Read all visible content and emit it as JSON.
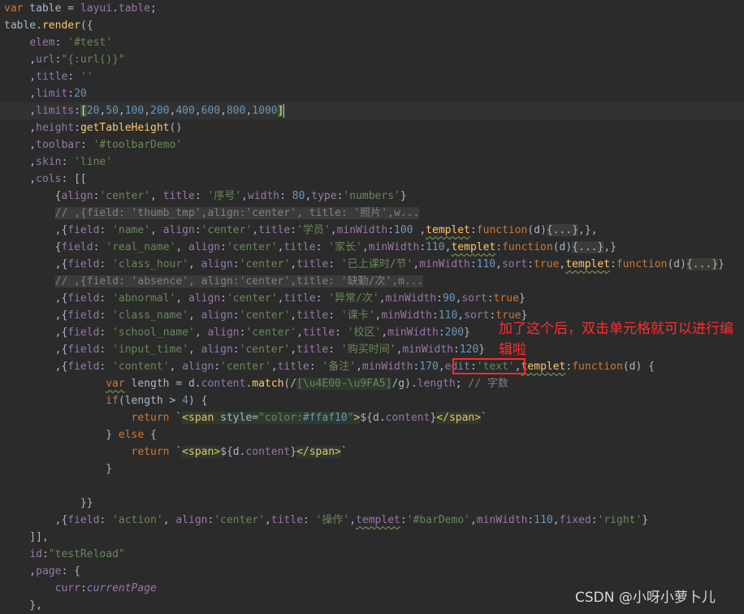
{
  "editor": {
    "highlighted_line": 7,
    "lines": [
      [
        [
          "k",
          "var"
        ],
        [
          "t",
          " table = "
        ],
        [
          "p",
          "layui"
        ],
        [
          "t",
          "."
        ],
        [
          "p",
          "table"
        ],
        [
          "t",
          ";"
        ]
      ],
      [
        [
          "t",
          "table."
        ],
        [
          "f",
          "render"
        ],
        [
          "t",
          "({"
        ]
      ],
      [
        [
          "t",
          "    "
        ],
        [
          "p",
          "elem"
        ],
        [
          "t",
          ": "
        ],
        [
          "s",
          "'#test'"
        ]
      ],
      [
        [
          "t",
          "    ,"
        ],
        [
          "p",
          "url"
        ],
        [
          "t",
          ":"
        ],
        [
          "s",
          "\"{:url()}\""
        ]
      ],
      [
        [
          "t",
          "    ,"
        ],
        [
          "p",
          "title"
        ],
        [
          "t",
          ": "
        ],
        [
          "s",
          "''"
        ]
      ],
      [
        [
          "t",
          "    ,"
        ],
        [
          "p",
          "limit"
        ],
        [
          "t",
          ":"
        ],
        [
          "n",
          "20"
        ]
      ],
      [
        [
          "t",
          "    ,"
        ],
        [
          "p",
          "limits"
        ],
        [
          "t",
          ":"
        ],
        [
          "br",
          "["
        ],
        [
          "n",
          "20"
        ],
        [
          "t",
          ","
        ],
        [
          "n",
          "50"
        ],
        [
          "t",
          ","
        ],
        [
          "n",
          "100"
        ],
        [
          "t",
          ","
        ],
        [
          "n",
          "200"
        ],
        [
          "t",
          ","
        ],
        [
          "n",
          "400"
        ],
        [
          "t",
          ","
        ],
        [
          "n",
          "600"
        ],
        [
          "t",
          ","
        ],
        [
          "n",
          "800"
        ],
        [
          "t",
          ","
        ],
        [
          "n",
          "1000"
        ],
        [
          "br",
          "]"
        ],
        [
          "caret",
          ""
        ]
      ],
      [
        [
          "t",
          "    ,"
        ],
        [
          "p",
          "height"
        ],
        [
          "t",
          ":"
        ],
        [
          "f",
          "getTableHeight"
        ],
        [
          "t",
          "()"
        ]
      ],
      [
        [
          "t",
          "    ,"
        ],
        [
          "p",
          "toolbar"
        ],
        [
          "t",
          ": "
        ],
        [
          "s",
          "'#toolbarDemo'"
        ]
      ],
      [
        [
          "t",
          "    ,"
        ],
        [
          "p",
          "skin"
        ],
        [
          "t",
          ": "
        ],
        [
          "s",
          "'line'"
        ]
      ],
      [
        [
          "t",
          "    ,"
        ],
        [
          "p",
          "cols"
        ],
        [
          "t",
          ": [["
        ]
      ],
      [
        [
          "t",
          "        {"
        ],
        [
          "p",
          "align"
        ],
        [
          "t",
          ":"
        ],
        [
          "s",
          "'center'"
        ],
        [
          "t",
          ", "
        ],
        [
          "p",
          "title"
        ],
        [
          "t",
          ": "
        ],
        [
          "s",
          "'序号'"
        ],
        [
          "t",
          ","
        ],
        [
          "p",
          "width"
        ],
        [
          "t",
          ": "
        ],
        [
          "n",
          "80"
        ],
        [
          "t",
          ","
        ],
        [
          "p",
          "type"
        ],
        [
          "t",
          ":"
        ],
        [
          "s",
          "'numbers'"
        ],
        [
          "t",
          "}"
        ]
      ],
      [
        [
          "t",
          "        "
        ],
        [
          "c",
          "// ,{field: 'thumb_tmp',align:'center', title: '照片',w..."
        ]
      ],
      [
        [
          "t",
          "        ,{"
        ],
        [
          "p",
          "field"
        ],
        [
          "t",
          ": "
        ],
        [
          "s",
          "'name'"
        ],
        [
          "t",
          ", "
        ],
        [
          "p",
          "align"
        ],
        [
          "t",
          ":"
        ],
        [
          "s",
          "'center'"
        ],
        [
          "t",
          ","
        ],
        [
          "p",
          "title"
        ],
        [
          "t",
          ":"
        ],
        [
          "s",
          "'学员'"
        ],
        [
          "t",
          ","
        ],
        [
          "p",
          "minWidth"
        ],
        [
          "t",
          ":"
        ],
        [
          "n",
          "100"
        ],
        [
          "t",
          " ,"
        ],
        [
          "fwv",
          "templet"
        ],
        [
          "t",
          ":"
        ],
        [
          "k",
          "function"
        ],
        [
          "t",
          "(d)"
        ],
        [
          "fold",
          "{...}"
        ],
        [
          "t",
          ",},"
        ]
      ],
      [
        [
          "t",
          "        {"
        ],
        [
          "p",
          "field"
        ],
        [
          "t",
          ": "
        ],
        [
          "s",
          "'real_name'"
        ],
        [
          "t",
          ", "
        ],
        [
          "p",
          "align"
        ],
        [
          "t",
          ":"
        ],
        [
          "s",
          "'center'"
        ],
        [
          "t",
          ","
        ],
        [
          "p",
          "title"
        ],
        [
          "t",
          ": "
        ],
        [
          "s",
          "'家长'"
        ],
        [
          "t",
          ","
        ],
        [
          "p",
          "minWidth"
        ],
        [
          "t",
          ":"
        ],
        [
          "n",
          "110"
        ],
        [
          "t",
          ","
        ],
        [
          "fwv",
          "templet"
        ],
        [
          "t",
          ":"
        ],
        [
          "k",
          "function"
        ],
        [
          "t",
          "(d)"
        ],
        [
          "fold",
          "{...}"
        ],
        [
          "t",
          ",}"
        ]
      ],
      [
        [
          "t",
          "        ,{"
        ],
        [
          "p",
          "field"
        ],
        [
          "t",
          ": "
        ],
        [
          "s",
          "'class_hour'"
        ],
        [
          "t",
          ", "
        ],
        [
          "p",
          "align"
        ],
        [
          "t",
          ":"
        ],
        [
          "s",
          "'center'"
        ],
        [
          "t",
          ","
        ],
        [
          "p",
          "title"
        ],
        [
          "t",
          ": "
        ],
        [
          "s",
          "'已上课时/节'"
        ],
        [
          "t",
          ","
        ],
        [
          "p",
          "minWidth"
        ],
        [
          "t",
          ":"
        ],
        [
          "n",
          "110"
        ],
        [
          "t",
          ","
        ],
        [
          "p",
          "sort"
        ],
        [
          "t",
          ":"
        ],
        [
          "k",
          "true"
        ],
        [
          "t",
          ","
        ],
        [
          "fwv",
          "templet"
        ],
        [
          "t",
          ":"
        ],
        [
          "k",
          "function"
        ],
        [
          "t",
          "(d)"
        ],
        [
          "foldy",
          "{...}"
        ],
        [
          "t",
          "}"
        ]
      ],
      [
        [
          "t",
          "        "
        ],
        [
          "c",
          "// ,{field: 'absence', align:'center',title: '缺勤/次',m..."
        ]
      ],
      [
        [
          "t",
          "        ,{"
        ],
        [
          "p",
          "field"
        ],
        [
          "t",
          ": "
        ],
        [
          "s",
          "'abnormal'"
        ],
        [
          "t",
          ", "
        ],
        [
          "p",
          "align"
        ],
        [
          "t",
          ":"
        ],
        [
          "s",
          "'center'"
        ],
        [
          "t",
          ","
        ],
        [
          "p",
          "title"
        ],
        [
          "t",
          ": "
        ],
        [
          "s",
          "'异常/次'"
        ],
        [
          "t",
          ","
        ],
        [
          "p",
          "minWidth"
        ],
        [
          "t",
          ":"
        ],
        [
          "n",
          "90"
        ],
        [
          "t",
          ","
        ],
        [
          "p",
          "sort"
        ],
        [
          "t",
          ":"
        ],
        [
          "k",
          "true"
        ],
        [
          "t",
          "}"
        ]
      ],
      [
        [
          "t",
          "        ,{"
        ],
        [
          "p",
          "field"
        ],
        [
          "t",
          ": "
        ],
        [
          "s",
          "'class_name'"
        ],
        [
          "t",
          ", "
        ],
        [
          "p",
          "align"
        ],
        [
          "t",
          ":"
        ],
        [
          "s",
          "'center'"
        ],
        [
          "t",
          ","
        ],
        [
          "p",
          "title"
        ],
        [
          "t",
          ": "
        ],
        [
          "s",
          "'课卡'"
        ],
        [
          "t",
          ","
        ],
        [
          "p",
          "minWidth"
        ],
        [
          "t",
          ":"
        ],
        [
          "n",
          "110"
        ],
        [
          "t",
          ","
        ],
        [
          "p",
          "sort"
        ],
        [
          "t",
          ":"
        ],
        [
          "k",
          "true"
        ],
        [
          "t",
          "}"
        ]
      ],
      [
        [
          "t",
          "        ,{"
        ],
        [
          "p",
          "field"
        ],
        [
          "t",
          ": "
        ],
        [
          "s",
          "'school_name'"
        ],
        [
          "t",
          ", "
        ],
        [
          "p",
          "align"
        ],
        [
          "t",
          ":"
        ],
        [
          "s",
          "'center'"
        ],
        [
          "t",
          ","
        ],
        [
          "p",
          "title"
        ],
        [
          "t",
          ": "
        ],
        [
          "s",
          "'校区'"
        ],
        [
          "t",
          ","
        ],
        [
          "p",
          "minWidth"
        ],
        [
          "t",
          ":"
        ],
        [
          "n",
          "200"
        ],
        [
          "t",
          "}"
        ]
      ],
      [
        [
          "t",
          "        ,{"
        ],
        [
          "p",
          "field"
        ],
        [
          "t",
          ": "
        ],
        [
          "s",
          "'input_time'"
        ],
        [
          "t",
          ", "
        ],
        [
          "p",
          "align"
        ],
        [
          "t",
          ":"
        ],
        [
          "s",
          "'center'"
        ],
        [
          "t",
          ","
        ],
        [
          "p",
          "title"
        ],
        [
          "t",
          ": "
        ],
        [
          "s",
          "'购买时间'"
        ],
        [
          "t",
          ","
        ],
        [
          "p",
          "minWidth"
        ],
        [
          "t",
          ":"
        ],
        [
          "n",
          "120"
        ],
        [
          "t",
          "}"
        ]
      ],
      [
        [
          "t",
          "        ,{"
        ],
        [
          "p",
          "field"
        ],
        [
          "t",
          ": "
        ],
        [
          "s",
          "'content'"
        ],
        [
          "t",
          ", "
        ],
        [
          "p",
          "align"
        ],
        [
          "t",
          ":"
        ],
        [
          "s",
          "'center'"
        ],
        [
          "t",
          ","
        ],
        [
          "p",
          "title"
        ],
        [
          "t",
          ": "
        ],
        [
          "s",
          "'备注'"
        ],
        [
          "t",
          ","
        ],
        [
          "p",
          "minWidth"
        ],
        [
          "t",
          ":"
        ],
        [
          "n",
          "170"
        ],
        [
          "t",
          ","
        ],
        [
          "p",
          "edit"
        ],
        [
          "t",
          ":"
        ],
        [
          "s",
          "'text'"
        ],
        [
          "t",
          ","
        ],
        [
          "fwv",
          "templet"
        ],
        [
          "t",
          ":"
        ],
        [
          "k",
          "function"
        ],
        [
          "t",
          "(d) {"
        ]
      ],
      [
        [
          "t",
          "                "
        ],
        [
          "kwv",
          "var"
        ],
        [
          "t",
          " length = d."
        ],
        [
          "p",
          "content"
        ],
        [
          "t",
          "."
        ],
        [
          "f",
          "match"
        ],
        [
          "t",
          "(/"
        ],
        [
          "rx",
          "[\\u4E00-\\u9FA5]"
        ],
        [
          "t",
          "/g)."
        ],
        [
          "p",
          "length"
        ],
        [
          "t",
          "; "
        ],
        [
          "cc",
          "// 字数"
        ]
      ],
      [
        [
          "t",
          "                "
        ],
        [
          "k",
          "if"
        ],
        [
          "t",
          "(length > "
        ],
        [
          "n",
          "4"
        ],
        [
          "t",
          ") {"
        ]
      ],
      [
        [
          "t",
          "                    "
        ],
        [
          "k",
          "return"
        ],
        [
          "t",
          " `"
        ],
        [
          "tag",
          "<span "
        ],
        [
          "tagt",
          "style="
        ],
        [
          "tags",
          "\"color:"
        ],
        [
          "tagn",
          "#ffaf10"
        ],
        [
          "tags",
          "\""
        ],
        [
          "tag",
          ">"
        ],
        [
          "t",
          "${d."
        ],
        [
          "p",
          "content"
        ],
        [
          "t",
          "}"
        ],
        [
          "tag",
          "</span>"
        ],
        [
          "t",
          "`"
        ]
      ],
      [
        [
          "t",
          "                } "
        ],
        [
          "k",
          "else"
        ],
        [
          "t",
          " {"
        ]
      ],
      [
        [
          "t",
          "                    "
        ],
        [
          "k",
          "return"
        ],
        [
          "t",
          " `"
        ],
        [
          "tag",
          "<span>"
        ],
        [
          "t",
          "${d."
        ],
        [
          "p",
          "content"
        ],
        [
          "t",
          "}"
        ],
        [
          "tag",
          "</span>"
        ],
        [
          "t",
          "`"
        ]
      ],
      [
        [
          "t",
          "                }"
        ]
      ],
      [],
      [
        [
          "t",
          "            }}"
        ]
      ],
      [
        [
          "t",
          "        ,{"
        ],
        [
          "p",
          "field"
        ],
        [
          "t",
          ": "
        ],
        [
          "s",
          "'action'"
        ],
        [
          "t",
          ", "
        ],
        [
          "p",
          "align"
        ],
        [
          "t",
          ":"
        ],
        [
          "s",
          "'center'"
        ],
        [
          "t",
          ","
        ],
        [
          "p",
          "title"
        ],
        [
          "t",
          ": "
        ],
        [
          "s",
          "'操作'"
        ],
        [
          "t",
          ","
        ],
        [
          "pwv",
          "templet"
        ],
        [
          "t",
          ":"
        ],
        [
          "s",
          "'#barDemo'"
        ],
        [
          "t",
          ","
        ],
        [
          "p",
          "minWidth"
        ],
        [
          "t",
          ":"
        ],
        [
          "n",
          "110"
        ],
        [
          "t",
          ","
        ],
        [
          "p",
          "fixed"
        ],
        [
          "t",
          ":"
        ],
        [
          "s",
          "'right'"
        ],
        [
          "t",
          "}"
        ]
      ],
      [
        [
          "t",
          "    ]],"
        ]
      ],
      [
        [
          "t",
          "    "
        ],
        [
          "p",
          "id"
        ],
        [
          "t",
          ":"
        ],
        [
          "s",
          "\"testReload\""
        ]
      ],
      [
        [
          "t",
          "    ,"
        ],
        [
          "p",
          "page"
        ],
        [
          "t",
          ": {"
        ]
      ],
      [
        [
          "t",
          "        "
        ],
        [
          "p",
          "curr"
        ],
        [
          "t",
          ":"
        ],
        [
          "i",
          "currentPage"
        ]
      ],
      [
        [
          "t",
          "    },"
        ]
      ]
    ]
  },
  "annotation": {
    "text": "加了这个后，双击单元格就可以进行编辑啦",
    "color": "#ff2d2d"
  },
  "watermark": "CSDN @小呀小萝卜儿",
  "theme": {
    "background": "#2b2b2b",
    "keyword": "#cc7832",
    "property": "#9876aa",
    "string": "#6a8759",
    "number": "#6897bb",
    "function": "#ffc66d"
  }
}
